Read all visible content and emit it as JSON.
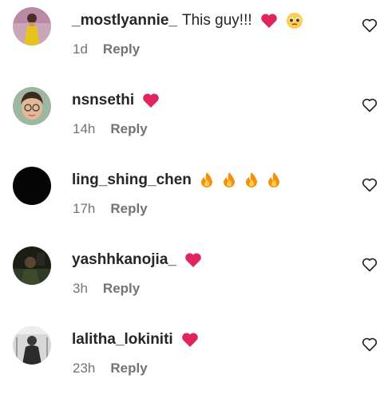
{
  "comments": [
    {
      "username": "_mostlyannie_",
      "text": "This guy!!!",
      "emojis": [
        "red-heart",
        "pleading-face"
      ],
      "time": "1d",
      "reply_label": "Reply",
      "avatar": "avatar-woman-yellow-dress"
    },
    {
      "username": "nsnsethi",
      "text": "",
      "emojis": [
        "red-heart"
      ],
      "time": "14h",
      "reply_label": "Reply",
      "avatar": "avatar-cartoon-woman-glasses"
    },
    {
      "username": "ling_shing_chen",
      "text": "",
      "emojis": [
        "fire",
        "fire",
        "fire",
        "fire"
      ],
      "time": "17h",
      "reply_label": "Reply",
      "avatar": "avatar-black"
    },
    {
      "username": "yashhkanojia_",
      "text": "",
      "emojis": [
        "red-heart"
      ],
      "time": "3h",
      "reply_label": "Reply",
      "avatar": "avatar-dark-photo"
    },
    {
      "username": "lalitha_lokiniti",
      "text": "",
      "emojis": [
        "red-heart"
      ],
      "time": "23h",
      "reply_label": "Reply",
      "avatar": "avatar-grey-photo"
    }
  ],
  "colors": {
    "text": "#262626",
    "meta": "#737373",
    "heart": "#e0245e",
    "fire": "#f4900c"
  }
}
